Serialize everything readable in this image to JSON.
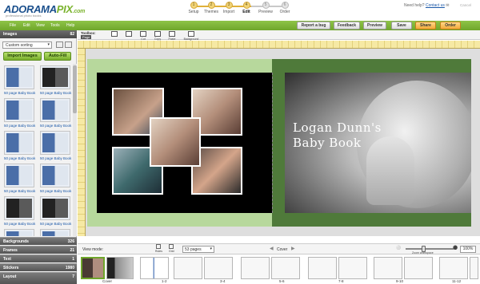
{
  "header": {
    "logo_main": "ADORAMA",
    "logo_accent": "PIX",
    "logo_suffix": ".com",
    "tagline": "professional photo books",
    "help_text": "Need help?",
    "help_link": "Contact us",
    "cancel": "Cancel",
    "steps": [
      {
        "num": "1",
        "label": "Setup",
        "state": "done"
      },
      {
        "num": "2",
        "label": "Themes",
        "state": "done"
      },
      {
        "num": "3",
        "label": "Import",
        "state": "done"
      },
      {
        "num": "4",
        "label": "Edit",
        "state": "active"
      },
      {
        "num": "5",
        "label": "Preview",
        "state": "pending"
      },
      {
        "num": "6",
        "label": "Order",
        "state": "pending"
      }
    ]
  },
  "menu": {
    "items": [
      "File",
      "Edit",
      "View",
      "Tools",
      "Help"
    ],
    "report_bug": "Report a bug",
    "feedback": "Feedback",
    "preview": "Preview",
    "save": "Save",
    "share": "Share",
    "order": "Order"
  },
  "images_panel": {
    "title": "Images",
    "count": "82",
    "sort_value": "Custom sorting",
    "import_button": "Import Images",
    "autofill_button": "Auto-Fill",
    "thumb_labels": [
      "50 page Baby Book",
      "50 page Baby Book",
      "50 page Baby Book",
      "50 page Baby Book",
      "50 page Baby Book",
      "50 page Baby Book",
      "50 page Baby Book",
      "50 page Baby Book",
      "50 page Baby Book",
      "50 page Baby Book",
      "50 page Baby Book",
      "50 page Baby Book"
    ]
  },
  "accordion": [
    {
      "label": "Backgrounds",
      "count": "326"
    },
    {
      "label": "Frames",
      "count": "21"
    },
    {
      "label": "Text",
      "count": "1"
    },
    {
      "label": "Stickers",
      "count": "1980"
    },
    {
      "label": "Layout",
      "count": "7"
    }
  ],
  "toolbar": {
    "title": "Toolbox:",
    "page_tag": "Page",
    "tools": [
      "",
      "",
      "Cut",
      "Copy",
      "Paste",
      "Background"
    ]
  },
  "book": {
    "title_line1": "Logan Dunn's",
    "title_line2": "Baby Book"
  },
  "bottom": {
    "view_mode": "View mode:",
    "rules": "Rules",
    "grid": "Grid",
    "pages_value": "53 pages",
    "cover": "Cover",
    "zoom_label": "Zoom workspace",
    "zoom_pct": "100%"
  },
  "page_strip": {
    "labels": [
      "Cover",
      "1-2",
      "3-4",
      "5-6",
      "7-8",
      "9-10",
      "11-12"
    ]
  }
}
